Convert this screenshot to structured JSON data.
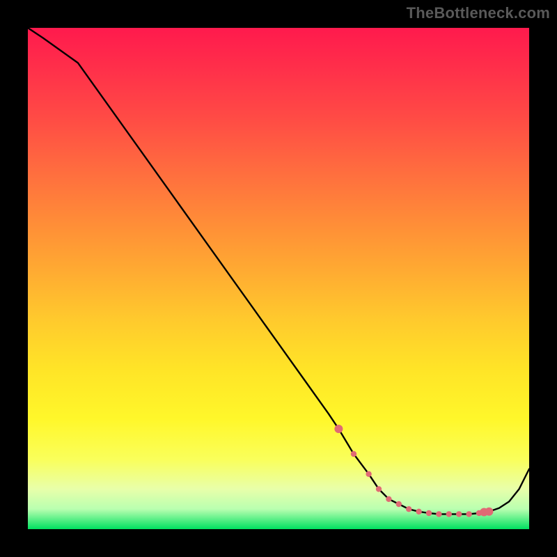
{
  "watermark": "TheBottleneck.com",
  "colors": {
    "bg": "#000000",
    "line": "#000000",
    "marker": "#e06a74",
    "gradient_top": "#ff1a4d",
    "gradient_bottom": "#00e060"
  },
  "chart_data": {
    "type": "line",
    "title": "",
    "xlabel": "",
    "ylabel": "",
    "xlim": [
      0,
      100
    ],
    "ylim": [
      0,
      100
    ],
    "grid": false,
    "legend": false,
    "x": [
      0,
      3,
      10,
      15,
      20,
      25,
      30,
      35,
      40,
      45,
      50,
      55,
      60,
      62,
      65,
      68,
      70,
      72,
      74,
      76,
      78,
      80,
      82,
      84,
      86,
      88,
      90,
      92,
      94,
      96,
      98,
      100
    ],
    "values": [
      100,
      98,
      93,
      86,
      79,
      72,
      65,
      58,
      51,
      44,
      37,
      30,
      23,
      20,
      15,
      11,
      8,
      6,
      5,
      4,
      3.5,
      3.2,
      3,
      3,
      3,
      3,
      3.2,
      3.5,
      4.2,
      5.5,
      8,
      12
    ],
    "markers": {
      "comment": "highlighted sample points along the valley",
      "points_x": [
        62,
        65,
        68,
        70,
        72,
        74,
        76,
        78,
        80,
        82,
        84,
        86,
        88,
        90,
        91,
        92
      ],
      "points_y": [
        20,
        15,
        11,
        8,
        6,
        5,
        4,
        3.5,
        3.2,
        3,
        3,
        3,
        3,
        3.2,
        3.4,
        3.5
      ]
    }
  }
}
